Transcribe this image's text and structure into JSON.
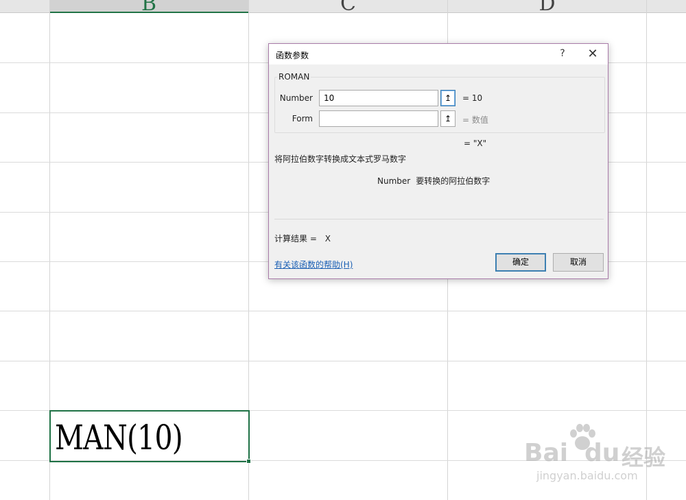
{
  "sheet": {
    "columns": [
      "B",
      "C",
      "D"
    ],
    "active_cell_text": "MAN(10)"
  },
  "dialog": {
    "title": "函数参数",
    "help_symbol": "?",
    "close_symbol": "✕",
    "function_name": "ROMAN",
    "args": [
      {
        "label": "Number",
        "value": "10",
        "result": "= 10"
      },
      {
        "label": "Form",
        "value": "",
        "result": "= 数值"
      }
    ],
    "ref_button_symbol": "↥",
    "formula_result": "= \"X\"",
    "description": "将阿拉伯数字转换成文本式罗马数字",
    "param_name": "Number",
    "param_description": "要转换的阿拉伯数字",
    "calc_result_label": "计算结果 =",
    "calc_result_value": "X",
    "help_link": "有关该函数的帮助(H)",
    "ok_label": "确定",
    "cancel_label": "取消"
  },
  "watermark": {
    "brand_left": "Bai",
    "brand_right": "du",
    "brand_suffix": "经验",
    "url": "jingyan.baidu.com"
  },
  "colors": {
    "accent": "#217346",
    "selection_border": "#1e7145",
    "link": "#1a5fb4",
    "dialog_border": "#a87aa8"
  }
}
